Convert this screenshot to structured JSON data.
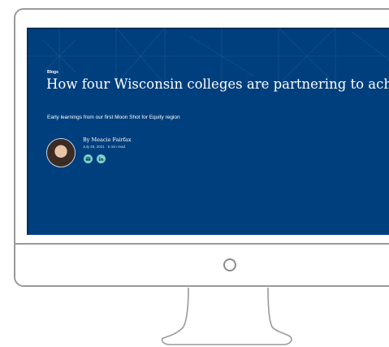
{
  "article": {
    "category": "Blogs",
    "title": "How four Wisconsin colleges are partnering to achieve racial equity",
    "subtitle": "Early learnings from our first Moon Shot for Equity region",
    "author": "By Meacie Fairfax",
    "meta": "July 26, 2021 · 5 min read",
    "share_icons": [
      "email-icon",
      "linkedin-icon"
    ]
  },
  "colors": {
    "screen_background": "#003f7d",
    "share_accent": "#7fd0c5",
    "frame": "#9a9a9a"
  }
}
